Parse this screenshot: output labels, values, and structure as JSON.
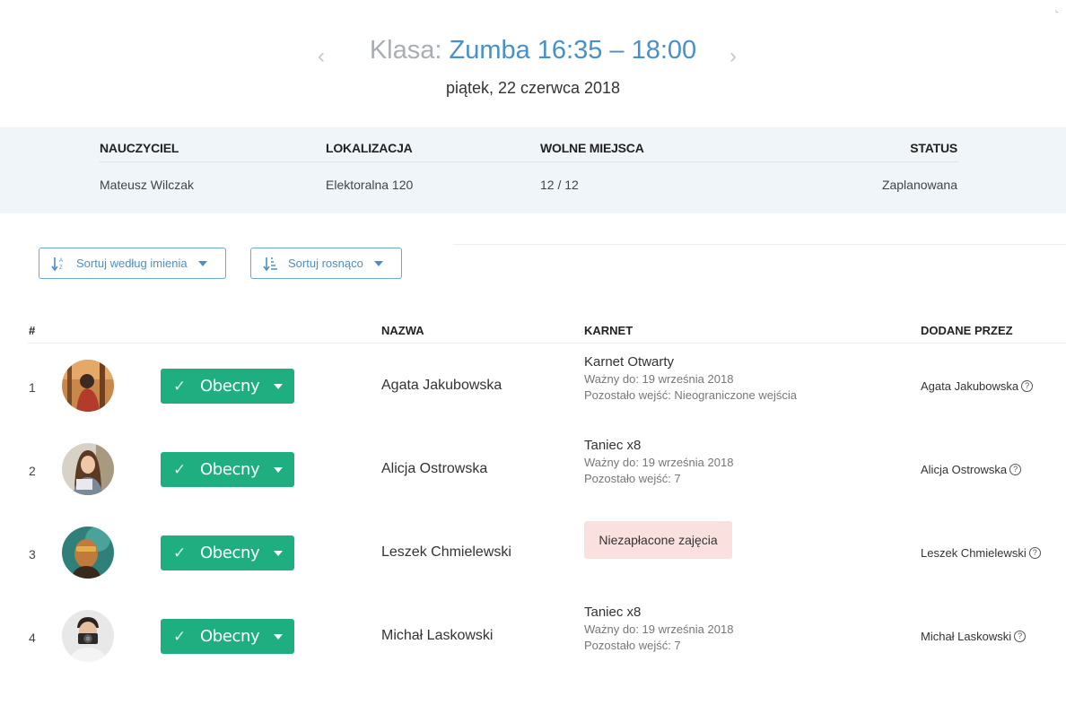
{
  "header": {
    "title_prefix": "Klasa:",
    "title_name": "Zumba 16:35 – 18:00",
    "date": "piątek, 22 czerwca 2018",
    "prev_icon": "‹",
    "next_icon": "›"
  },
  "info": {
    "teacher_label": "NAUCZYCIEL",
    "teacher": "Mateusz Wilczak",
    "location_label": "LOKALIZACJA",
    "location": "Elektoralna 120",
    "spots_label": "WOLNE MIEJSCA",
    "spots": "12 / 12",
    "status_label": "STATUS",
    "status": "Zaplanowana"
  },
  "sort": {
    "by_name": "Sortuj według imienia",
    "direction": "Sortuj rosnąco"
  },
  "table": {
    "col_num": "#",
    "col_name": "NAZWA",
    "col_pass": "KARNET",
    "col_added": "DODANE PRZEZ",
    "rows": [
      {
        "num": "1",
        "status": "Obecny",
        "name": "Agata Jakubowska",
        "pass_name": "Karnet Otwarty",
        "valid": "Ważny do: 19 września 2018",
        "remaining": "Pozostało wejść: Nieograniczone wejścia",
        "added_by": "Agata Jakubowska"
      },
      {
        "num": "2",
        "status": "Obecny",
        "name": "Alicja Ostrowska",
        "pass_name": "Taniec x8",
        "valid": "Ważny do: 19 września 2018",
        "remaining": "Pozostało wejść: 7",
        "added_by": "Alicja Ostrowska"
      },
      {
        "num": "3",
        "status": "Obecny",
        "name": "Leszek Chmielewski",
        "unpaid": "Niezapłacone zajęcia",
        "added_by": "Leszek Chmielewski"
      },
      {
        "num": "4",
        "status": "Obecny",
        "name": "Michał Laskowski",
        "pass_name": "Taniec x8",
        "valid": "Ważny do: 19 września 2018",
        "remaining": "Pozostało wejść: 7",
        "added_by": "Michał Laskowski"
      }
    ]
  },
  "colors": {
    "accent": "#4a90c8",
    "present": "#1fae7f",
    "unpaid_bg": "#fbe0e0",
    "info_bg": "#eff5f9"
  }
}
